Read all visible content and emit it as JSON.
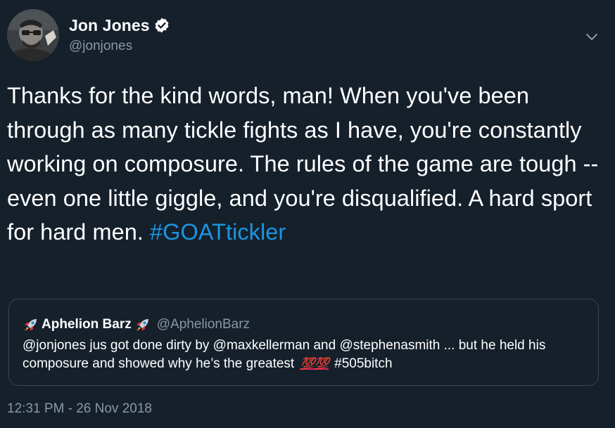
{
  "author": {
    "display_name": "Jon Jones",
    "handle": "@jonjones",
    "verified": true,
    "avatar_icon": "avatar-photo"
  },
  "menu": {
    "icon": "chevron-down-icon"
  },
  "tweet": {
    "text": "Thanks for the kind words, man! When you've been through as many tickle fights as I have, you're constantly working on composure. The rules of the game are tough -- even one little giggle, and you're disqualified. A hard sport for hard men. ",
    "hashtag": "#GOATtickler"
  },
  "quoted_tweet": {
    "display_name": "Aphelion Barz",
    "handle": "@AphelionBarz",
    "name_icon": "rocket-icon",
    "text_part1": "@jonjones jus got done dirty by @maxkellerman and @stephenasmith ... but he held his composure and showed why he’s the greatest ",
    "emoji": "💯💯",
    "hashtag": "#505bitch"
  },
  "timestamp": "12:31 PM - 26 Nov 2018",
  "colors": {
    "background": "#15202b",
    "text": "#ffffff",
    "secondary": "#8899a6",
    "link": "#1b95e0",
    "border": "#38444d"
  }
}
